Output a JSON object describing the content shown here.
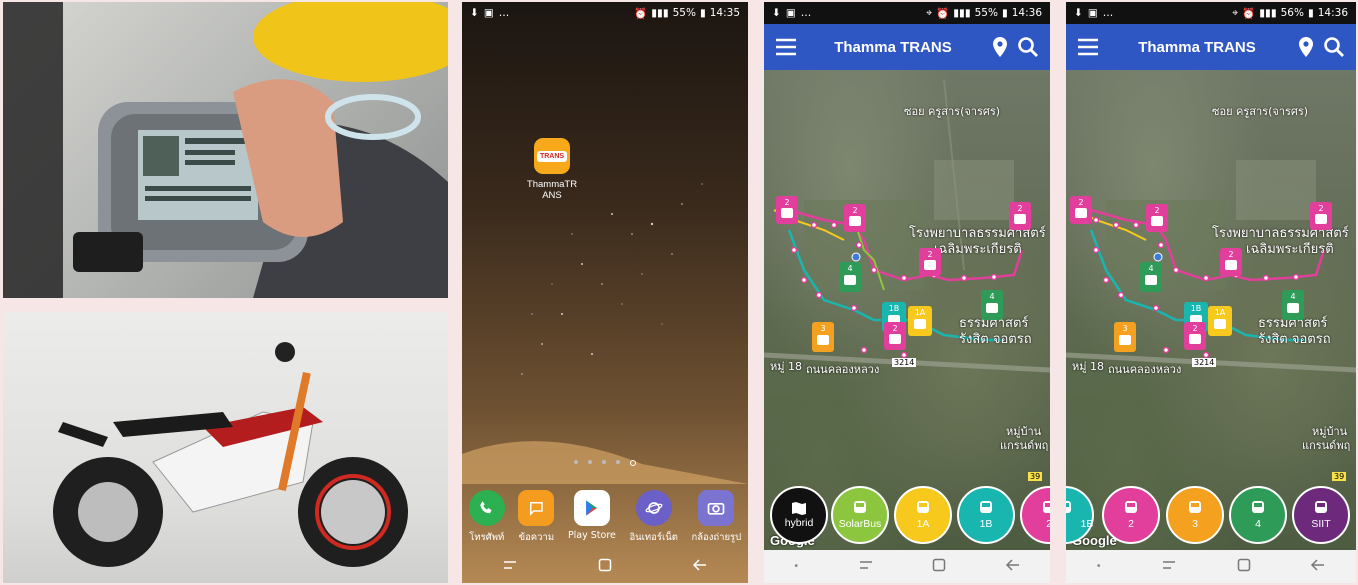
{
  "home_screen": {
    "status": {
      "time": "14:35",
      "battery": "55%"
    },
    "app_label": "ThammaTR\nANS",
    "app_logo_text": "TRANS",
    "dock": [
      {
        "label": "โทรศัพท์",
        "icon": "phone-icon",
        "color": "#2db052"
      },
      {
        "label": "ข้อความ",
        "icon": "message-icon",
        "color": "#f39c1f"
      },
      {
        "label": "Play Store",
        "icon": "play-store-icon",
        "color": "#ffffff"
      },
      {
        "label": "อินเทอร์เน็ต",
        "icon": "internet-icon",
        "color": "#6b5fc8"
      },
      {
        "label": "กล้องถ่ายรูป",
        "icon": "camera-icon",
        "color": "#7a73cf"
      }
    ]
  },
  "app": {
    "title": "Thamma TRANS",
    "brand_color": "#2f57c4",
    "map_labels": {
      "soi": "ซอย ครูสาร(จารศร)",
      "hospital_1": "โรงพยาบาลธรรมศาสตร์",
      "hospital_2": "เฉลิมพระเกียรติ",
      "campus_1": "ธรรมศาสตร์",
      "campus_2": "รังสิต จอตรถ",
      "moo": "หมู่ 18",
      "road": "ถนนคลองหลวง",
      "road_no": "3214",
      "village_1": "หมู่บ้าน",
      "village_2": "แกรนด์พฤ",
      "km": "39",
      "watermark": "Google"
    }
  },
  "map_screen_1": {
    "status": {
      "time": "14:36",
      "battery": "55%"
    },
    "buttons": [
      {
        "label": "hybrid",
        "color": "#111111",
        "icon": "map-icon"
      },
      {
        "label": "SolarBus",
        "color": "#8cc63f",
        "icon": "bus-icon"
      },
      {
        "label": "1A",
        "color": "#f7c91c",
        "icon": "bus-icon"
      },
      {
        "label": "1B",
        "color": "#19b6b0",
        "icon": "bus-icon"
      },
      {
        "label": "2",
        "color": "#e23e9c",
        "icon": "bus-icon"
      }
    ]
  },
  "map_screen_2": {
    "status": {
      "time": "14:36",
      "battery": "56%"
    },
    "buttons": [
      {
        "label": "1B",
        "color": "#19b6b0",
        "icon": "bus-icon"
      },
      {
        "label": "2",
        "color": "#e23e9c",
        "icon": "bus-icon"
      },
      {
        "label": "3",
        "color": "#f4a11f",
        "icon": "bus-icon"
      },
      {
        "label": "4",
        "color": "#2e9b58",
        "icon": "bus-icon"
      },
      {
        "label": "SIIT",
        "color": "#6d2a7c",
        "icon": "bus-icon"
      }
    ]
  },
  "bus_markers": [
    {
      "route": "2",
      "color": "#e23e9c"
    },
    {
      "route": "4",
      "color": "#2e9b58"
    },
    {
      "route": "1B",
      "color": "#19b6b0"
    },
    {
      "route": "1A",
      "color": "#f7c91c"
    },
    {
      "route": "3",
      "color": "#f4a11f"
    }
  ]
}
